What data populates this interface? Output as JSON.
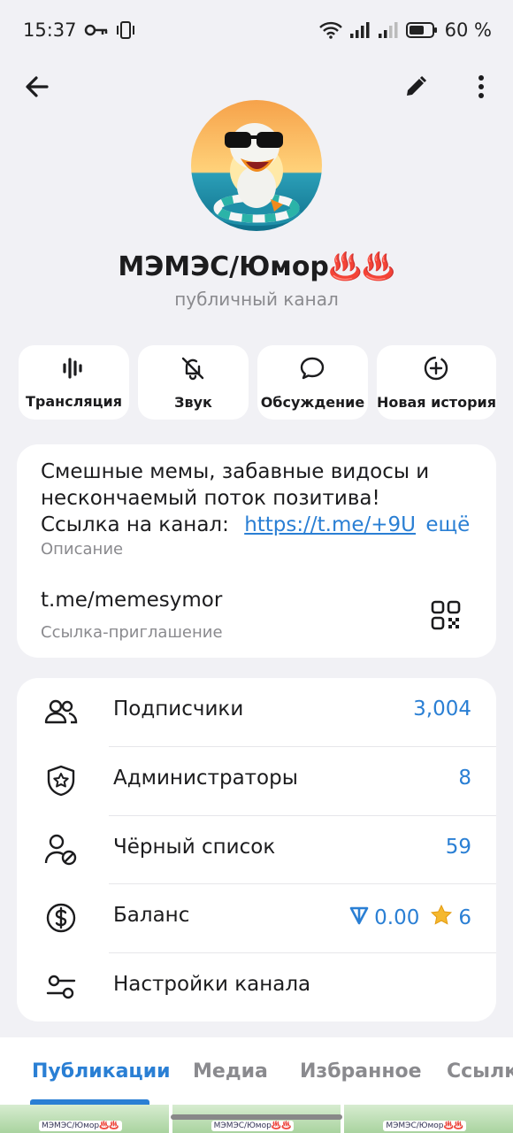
{
  "status_bar": {
    "time": "15:37",
    "battery": "60 %",
    "icons": [
      "key-icon",
      "vibrate-icon",
      "wifi-icon",
      "signal-icon",
      "signal-icon",
      "battery-icon"
    ]
  },
  "topbar": {
    "back_icon": "arrow-left-icon",
    "edit_icon": "pencil-icon",
    "menu_icon": "more-vertical-icon"
  },
  "channel": {
    "title": "МЭМЭС/Юмор♨️♨️",
    "subtitle": "публичный канал"
  },
  "actions": [
    {
      "label": "Трансляция",
      "icon": "live-stream-icon"
    },
    {
      "label": "Звук",
      "icon": "bell-off-icon"
    },
    {
      "label": "Обсуждение",
      "icon": "chat-bubble-icon"
    },
    {
      "label": "Новая история",
      "icon": "add-story-icon"
    }
  ],
  "description": {
    "line1": "Смешные мемы, забавные видосы и",
    "line2": "нескончаемый поток позитива!",
    "line3_prefix": "Ссылка на канал:",
    "line3_link": "https://t.me/+9U",
    "more": "ещё",
    "label": "Описание"
  },
  "invite": {
    "link": "t.me/memesymor",
    "label": "Ссылка-приглашение",
    "qr_icon": "qr-code-icon"
  },
  "stats": [
    {
      "label": "Подписчики",
      "value": "3,004",
      "icon": "users-icon"
    },
    {
      "label": "Администраторы",
      "value": "8",
      "icon": "shield-star-icon"
    },
    {
      "label": "Чёрный список",
      "value": "59",
      "icon": "user-blocked-icon"
    },
    {
      "label": "Баланс",
      "value_ton": "0.00",
      "value_stars": "6",
      "icon": "dollar-circle-icon"
    },
    {
      "label": "Настройки канала",
      "value": "",
      "icon": "sliders-icon"
    }
  ],
  "tabs": [
    {
      "label": "Публикации",
      "active": true
    },
    {
      "label": "Медиа",
      "active": false
    },
    {
      "label": "Избранное",
      "active": false
    },
    {
      "label": "Ссылки",
      "active": false
    }
  ],
  "thumbnail_caption": "МЭМЭС/Юмор♨️♨️",
  "colors": {
    "accent": "#2a7fd4",
    "background": "#f1f1f5",
    "card": "#ffffff",
    "secondary_text": "#8a8a8e"
  }
}
